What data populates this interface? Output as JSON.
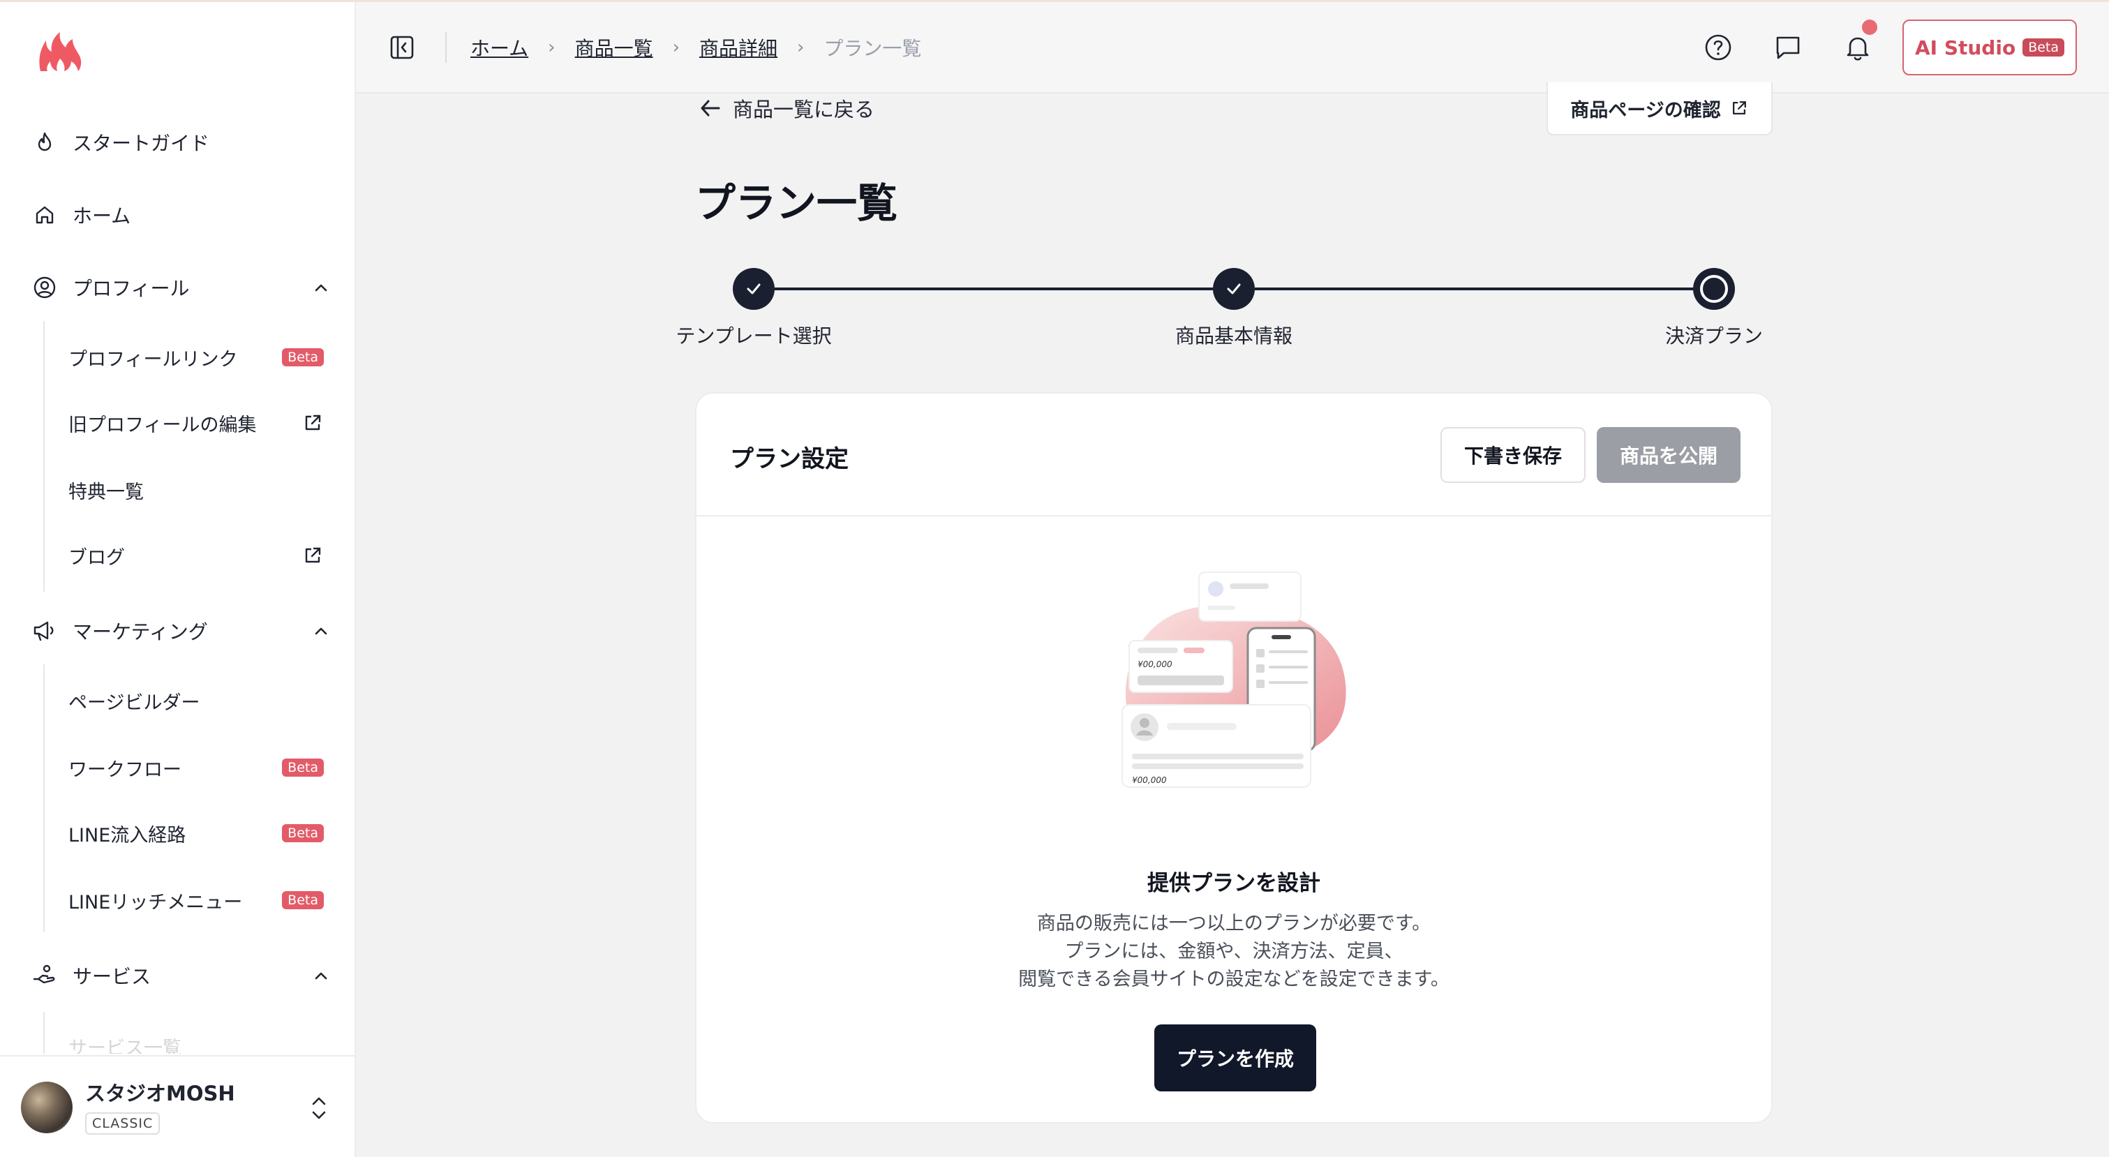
{
  "sidebar": {
    "logo_icon": "flame-logo-icon",
    "items": {
      "start_guide": "スタートガイド",
      "home": "ホーム",
      "profile": "プロフィール",
      "marketing": "マーケティング",
      "service": "サービス"
    },
    "profile_sub": {
      "profile_link": "プロフィールリンク",
      "old_profile_edit": "旧プロフィールの編集",
      "benefits": "特典一覧",
      "blog": "ブログ"
    },
    "marketing_sub": {
      "page_builder": "ページビルダー",
      "workflow": "ワークフロー",
      "line_source": "LINE流入経路",
      "line_rich_menu": "LINEリッチメニュー"
    },
    "service_sub": {
      "service_list": "サービス一覧"
    },
    "beta_label": "Beta",
    "user": {
      "name": "スタジオMOSH",
      "plan": "CLASSIC"
    }
  },
  "header": {
    "breadcrumb": [
      "ホーム",
      "商品一覧",
      "商品詳細",
      "プラン一覧"
    ],
    "ai_studio_label": "AI Studio",
    "ai_studio_badge": "Beta",
    "notification_dot_color": "#e96a73"
  },
  "main": {
    "back_label": "商品一覧に戻る",
    "preview_label": "商品ページの確認",
    "page_title": "プラン一覧",
    "steps": [
      {
        "label": "テンプレート選択",
        "status": "done"
      },
      {
        "label": "商品基本情報",
        "status": "done"
      },
      {
        "label": "決済プラン",
        "status": "current"
      }
    ],
    "card": {
      "title": "プラン設定",
      "draft_label": "下書き保存",
      "publish_label": "商品を公開",
      "empty_title": "提供プランを設計",
      "empty_desc_1": "商品の販売には一つ以上のプランが必要です。",
      "empty_desc_2": "プランには、金額や、決済方法、定員、",
      "empty_desc_3": "閲覧できる会員サイトの設定などを設定できます。",
      "create_label": "プランを作成",
      "illustration_price_1": "¥00,000",
      "illustration_price_2": "¥00,000"
    }
  },
  "colors": {
    "accent": "#e35b68",
    "dark": "#11182a",
    "disabled_button": "#9b9ea4"
  }
}
